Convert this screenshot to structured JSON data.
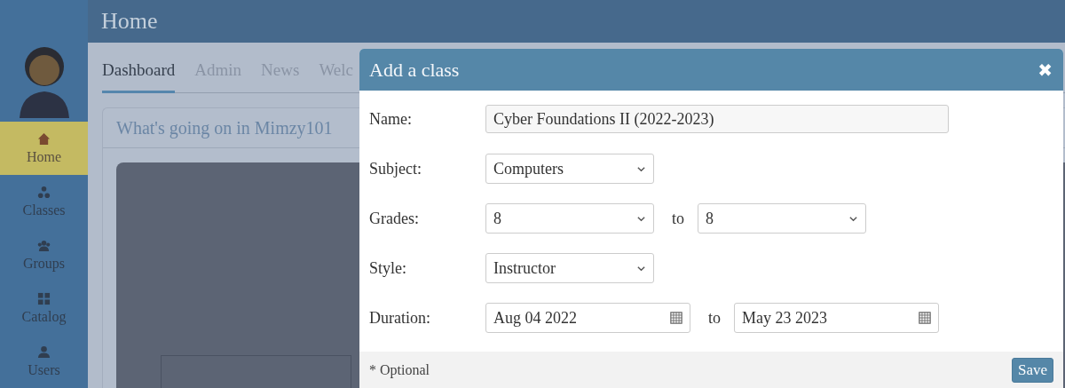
{
  "header": {
    "title": "Home"
  },
  "sidebar": {
    "items": [
      {
        "label": "Home",
        "kind": "house",
        "selected": true
      },
      {
        "label": "Classes",
        "kind": "cluster",
        "selected": false
      },
      {
        "label": "Groups",
        "kind": "people",
        "selected": false
      },
      {
        "label": "Catalog",
        "kind": "grid",
        "selected": false
      },
      {
        "label": "Users",
        "kind": "person",
        "selected": false
      }
    ]
  },
  "tabs": [
    {
      "label": "Dashboard",
      "selected": true
    },
    {
      "label": "Admin",
      "selected": false
    },
    {
      "label": "News",
      "selected": false
    },
    {
      "label": "Welc",
      "selected": false
    }
  ],
  "card": {
    "title": "What's going on in Mimzy101"
  },
  "dialog": {
    "title": "Add a class",
    "close": "✖",
    "rows": [
      {
        "kind": "text",
        "label": "Name:",
        "value": "Cyber Foundations II (2022-2023)"
      },
      {
        "kind": "select",
        "label": "Subject:",
        "value": "Computers"
      },
      {
        "kind": "select-range",
        "label": "Grades:",
        "value": "8",
        "separator": "to",
        "value_2": "8"
      },
      {
        "kind": "select",
        "label": "Style:",
        "value": "Instructor"
      },
      {
        "kind": "date-range",
        "label": "Duration:",
        "value": "Aug 04 2022",
        "separator": "to",
        "value_2": "May 23 2023"
      }
    ],
    "footer_note": "* Optional",
    "button": "Save"
  }
}
